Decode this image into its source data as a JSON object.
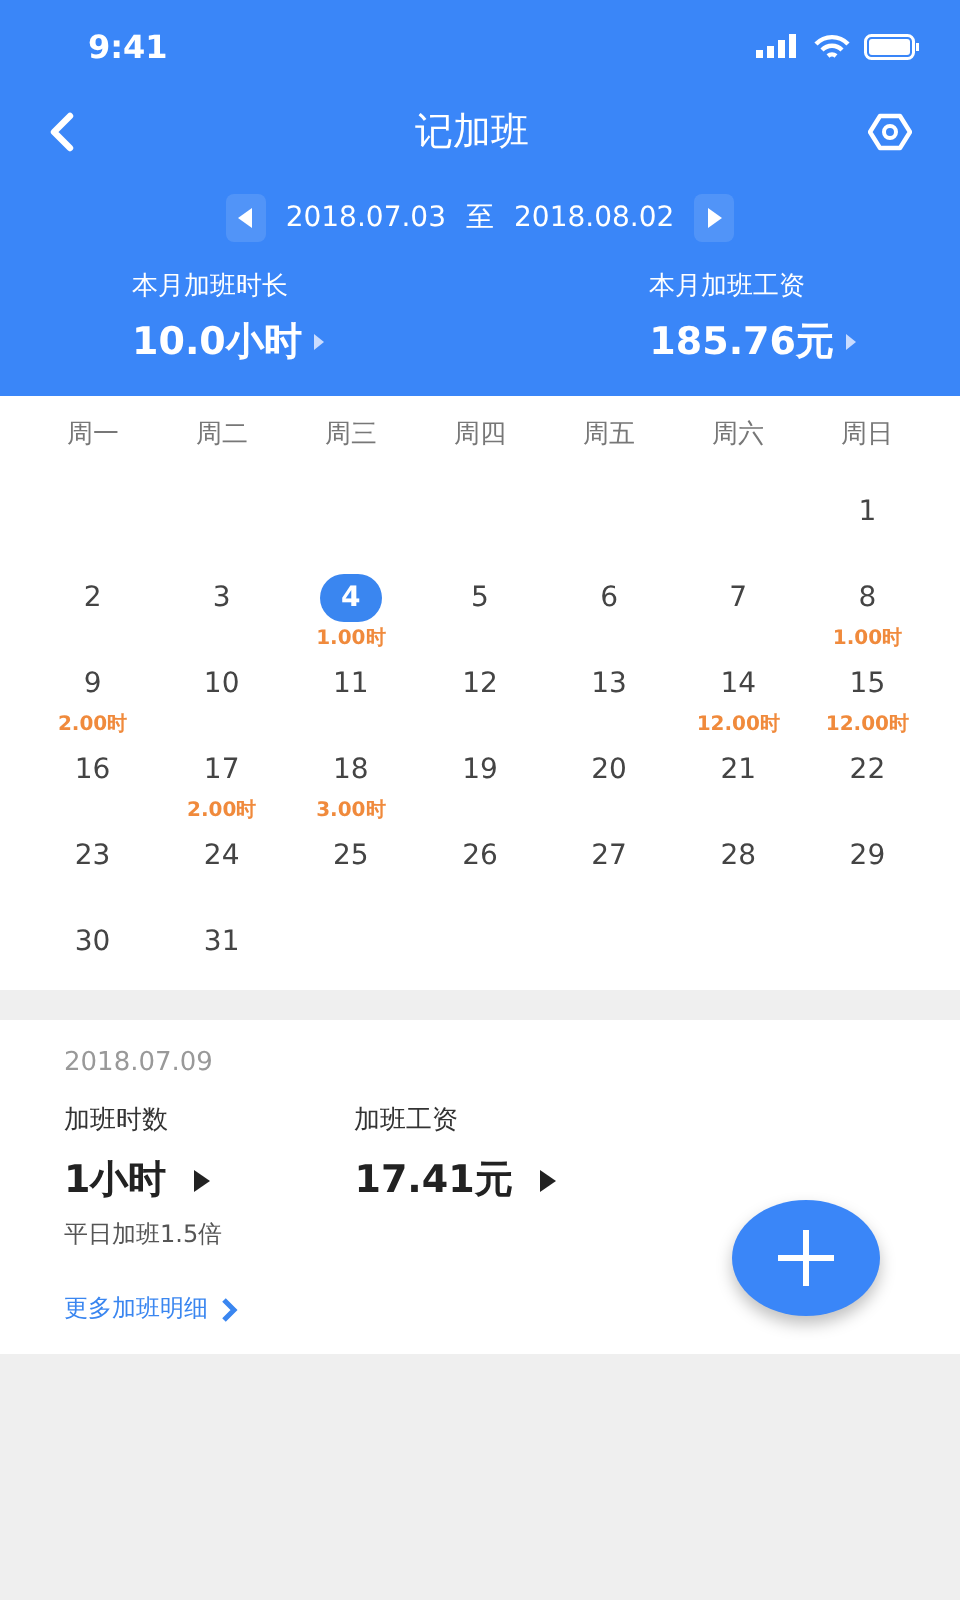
{
  "status_bar": {
    "time": "9:41"
  },
  "nav": {
    "title": "记加班"
  },
  "period": {
    "start": "2018.07.03",
    "separator": "至",
    "end": "2018.08.02"
  },
  "summary": [
    {
      "label": "本月加班时长",
      "value": "10.0小时"
    },
    {
      "label": "本月加班工资",
      "value": "185.76元"
    }
  ],
  "weekdays": [
    "周一",
    "周二",
    "周三",
    "周四",
    "周五",
    "周六",
    "周日"
  ],
  "weeks": [
    [
      {
        "kind": "blank"
      },
      {
        "kind": "blank"
      },
      {
        "kind": "blank"
      },
      {
        "kind": "blank"
      },
      {
        "kind": "blank"
      },
      {
        "kind": "blank"
      },
      {
        "kind": "day",
        "day": "1",
        "selected": false
      }
    ],
    [
      {
        "kind": "day",
        "day": "2",
        "selected": false
      },
      {
        "kind": "day",
        "day": "3",
        "selected": false
      },
      {
        "kind": "day",
        "day": "4",
        "selected": true,
        "hours": "1.00时"
      },
      {
        "kind": "day",
        "day": "5",
        "selected": false
      },
      {
        "kind": "day",
        "day": "6",
        "selected": false
      },
      {
        "kind": "day",
        "day": "7",
        "selected": false
      },
      {
        "kind": "day",
        "day": "8",
        "selected": false,
        "hours": "1.00时"
      }
    ],
    [
      {
        "kind": "day",
        "day": "9",
        "selected": false,
        "hours": "2.00时"
      },
      {
        "kind": "day",
        "day": "10",
        "selected": false
      },
      {
        "kind": "day",
        "day": "11",
        "selected": false
      },
      {
        "kind": "day",
        "day": "12",
        "selected": false
      },
      {
        "kind": "day",
        "day": "13",
        "selected": false
      },
      {
        "kind": "day",
        "day": "14",
        "selected": false,
        "hours": "12.00时"
      },
      {
        "kind": "day",
        "day": "15",
        "selected": false,
        "hours": "12.00时"
      }
    ],
    [
      {
        "kind": "day",
        "day": "16",
        "selected": false
      },
      {
        "kind": "day",
        "day": "17",
        "selected": false,
        "hours": "2.00时"
      },
      {
        "kind": "day",
        "day": "18",
        "selected": false,
        "hours": "3.00时"
      },
      {
        "kind": "day",
        "day": "19",
        "selected": false
      },
      {
        "kind": "day",
        "day": "20",
        "selected": false
      },
      {
        "kind": "day",
        "day": "21",
        "selected": false
      },
      {
        "kind": "day",
        "day": "22",
        "selected": false
      }
    ],
    [
      {
        "kind": "day",
        "day": "23",
        "selected": false
      },
      {
        "kind": "day",
        "day": "24",
        "selected": false
      },
      {
        "kind": "day",
        "day": "25",
        "selected": false
      },
      {
        "kind": "day",
        "day": "26",
        "selected": false
      },
      {
        "kind": "day",
        "day": "27",
        "selected": false
      },
      {
        "kind": "day",
        "day": "28",
        "selected": false
      },
      {
        "kind": "day",
        "day": "29",
        "selected": false
      }
    ],
    [
      {
        "kind": "day",
        "day": "30",
        "selected": false
      },
      {
        "kind": "day",
        "day": "31",
        "selected": false
      },
      {
        "kind": "blank"
      },
      {
        "kind": "blank"
      },
      {
        "kind": "blank"
      },
      {
        "kind": "blank"
      },
      {
        "kind": "blank"
      }
    ]
  ],
  "detail": {
    "date": "2018.07.09",
    "stats": [
      {
        "label": "加班时数",
        "value": "1小时"
      },
      {
        "label": "加班工资",
        "value": "17.41元"
      }
    ],
    "note": "平日加班1.5倍",
    "more_link": "更多加班明细"
  }
}
